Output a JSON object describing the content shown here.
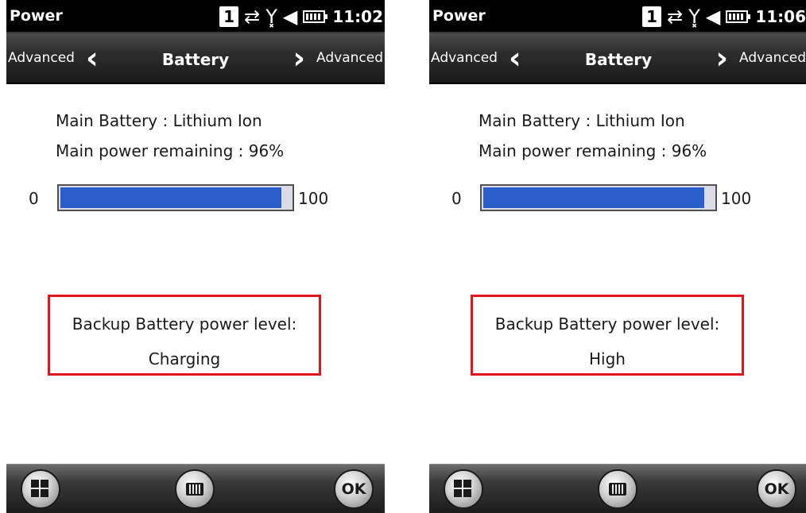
{
  "screens": [
    {
      "status": {
        "title": "Power",
        "sim_label": "1",
        "sync_icon": "sync-arrows-icon",
        "signal_icon": "no-signal-icon",
        "sound_icon": "speaker-icon",
        "battery_icon": "battery-icon",
        "time": "11:02"
      },
      "nav": {
        "prev_label": "Advanced",
        "title": "Battery",
        "next_label": "Advanced"
      },
      "main_battery": "Main Battery : Lithium Ion",
      "main_remaining": "Main power remaining : 96%",
      "progress": {
        "min_label": "0",
        "max_label": "100",
        "value_percent": 96,
        "fill_color": "#2b5fcc"
      },
      "backup": {
        "label": "Backup Battery power level:",
        "value": "Charging"
      },
      "bottom": {
        "start_icon": "windows-start-icon",
        "keyboard_icon": "keyboard-icon",
        "ok_label": "OK"
      }
    },
    {
      "status": {
        "title": "Power",
        "sim_label": "1",
        "sync_icon": "sync-arrows-icon",
        "signal_icon": "no-signal-icon",
        "sound_icon": "speaker-icon",
        "battery_icon": "battery-icon",
        "time": "11:06"
      },
      "nav": {
        "prev_label": "Advanced",
        "title": "Battery",
        "next_label": "Advanced"
      },
      "main_battery": "Main Battery : Lithium Ion",
      "main_remaining": "Main power remaining : 96%",
      "progress": {
        "min_label": "0",
        "max_label": "100",
        "value_percent": 96,
        "fill_color": "#2b5fcc"
      },
      "backup": {
        "label": "Backup Battery power level:",
        "value": "High"
      },
      "bottom": {
        "start_icon": "windows-start-icon",
        "keyboard_icon": "keyboard-icon",
        "ok_label": "OK"
      }
    }
  ],
  "colors": {
    "highlight_border": "#e0161c"
  }
}
